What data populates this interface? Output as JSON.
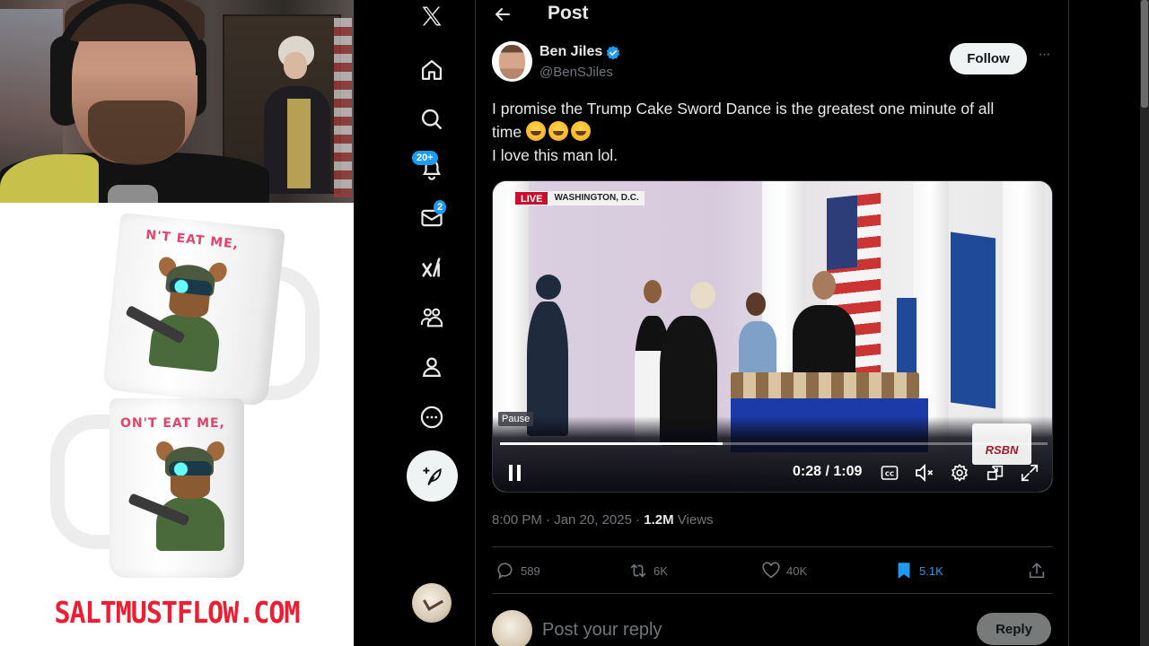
{
  "overlay": {
    "ad_url": "SALTMUSTFLOW.COM",
    "mug_text_top": "N'T EAT ME,",
    "mug_text_bottom": "ON'T EAT ME,"
  },
  "nav": {
    "items": [
      {
        "name": "x-logo",
        "label": "X"
      },
      {
        "name": "home",
        "label": "Home"
      },
      {
        "name": "explore",
        "label": "Explore"
      },
      {
        "name": "notifications",
        "label": "Notifications",
        "badge": "20+"
      },
      {
        "name": "messages",
        "label": "Messages",
        "badge": "2"
      },
      {
        "name": "grok",
        "label": "Grok"
      },
      {
        "name": "communities",
        "label": "Communities"
      },
      {
        "name": "profile",
        "label": "Profile"
      },
      {
        "name": "more",
        "label": "More"
      }
    ],
    "post_label": "Post"
  },
  "header": {
    "title": "Post"
  },
  "tweet": {
    "author_name": "Ben Jiles",
    "author_handle": "@BenSJiles",
    "verified": true,
    "follow_label": "Follow",
    "more_label": "···",
    "text_line1": "I promise the Trump Cake Sword Dance is the greatest one minute of all",
    "text_line2": "time",
    "emoji_count": 3,
    "emoji_name": "rolling-on-the-floor-laughing",
    "text_line3": "I love this man lol.",
    "timestamp": "8:00 PM · Jan 20, 2025 · ",
    "views_count": "1.2M",
    "views_label": " Views"
  },
  "video": {
    "live_label": "LIVE",
    "location_label": "WASHINGTON, D.C.",
    "watermark": "RSBN",
    "pause_tooltip": "Pause",
    "current_time": "0:28",
    "duration": "1:09",
    "time_display": "0:28 / 1:09",
    "progress_fraction": 0.406,
    "muted": true
  },
  "actions": {
    "replies": "589",
    "reposts": "6K",
    "likes": "40K",
    "bookmarks": "5.1K",
    "bookmark_color": "#1d9bf0"
  },
  "reply": {
    "placeholder": "Post your reply",
    "button_label": "Reply"
  },
  "colors": {
    "accent": "#1d9bf0",
    "background": "#000000",
    "text_primary": "#e7e9ea",
    "text_secondary": "#71767b",
    "ad_red": "#ee1d32"
  }
}
